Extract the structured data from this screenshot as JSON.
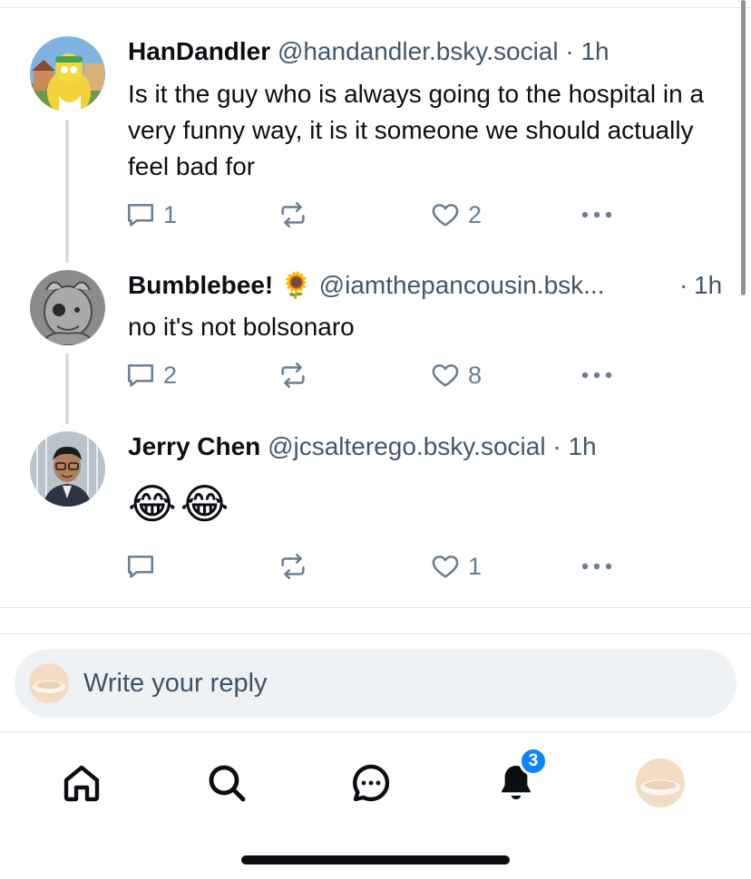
{
  "posts": [
    {
      "display_name": "HanDandler",
      "handle": "@handandler.bsky.social",
      "separator": "·",
      "time": "1h",
      "text": "Is it the guy who is always going to the hospital in a very funny way, it is it someone we should actually feel bad for",
      "reply_count": "1",
      "like_count": "2"
    },
    {
      "display_name": "Bumblebee! 🌻",
      "handle": "@iamthepancousin.bsk...",
      "separator": "·",
      "time": "1h",
      "text": "no it's not bolsonaro",
      "reply_count": "2",
      "like_count": "8"
    },
    {
      "display_name": "Jerry Chen",
      "handle": "@jcsalterego.bsky.social",
      "separator": "·",
      "time": "1h",
      "text": "😂😂",
      "reply_count": "",
      "like_count": "1"
    }
  ],
  "reply_bar": {
    "placeholder": "Write your reply"
  },
  "tabbar": {
    "items": [
      "home-icon",
      "search-icon",
      "chat-icon",
      "notifications-icon",
      "profile-avatar"
    ],
    "notifications_badge": "3"
  },
  "colors": {
    "accent": "#1083fe",
    "muted_text": "#42576c",
    "icon_gray": "#6a7e92",
    "thread_line": "#d4dbe2"
  }
}
